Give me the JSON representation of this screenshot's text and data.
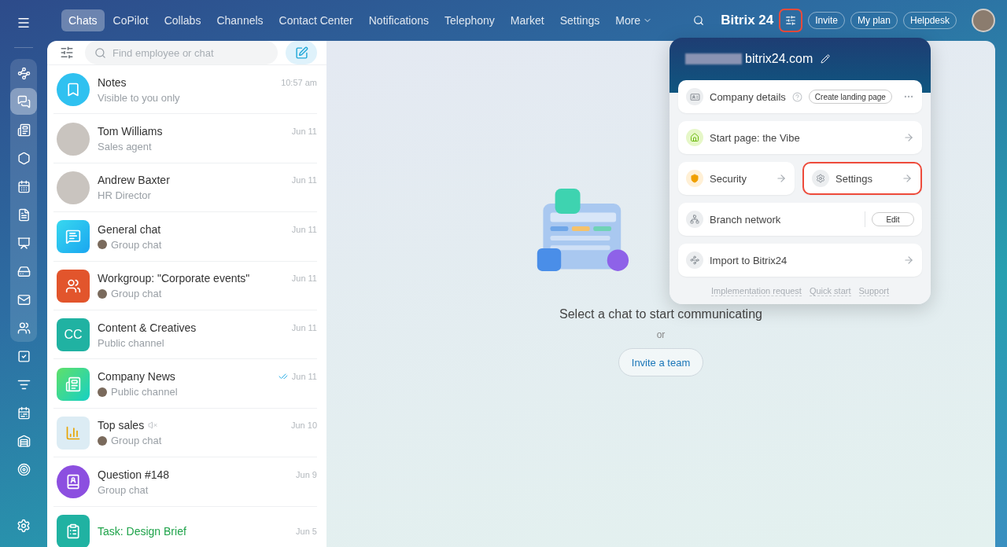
{
  "rail": {
    "items": [
      {
        "selected": false,
        "grouped": true
      },
      {
        "selected": true,
        "grouped": true
      },
      {
        "selected": false,
        "grouped": true
      },
      {
        "selected": false,
        "grouped": true
      },
      {
        "selected": false,
        "grouped": true
      },
      {
        "selected": false,
        "grouped": true
      },
      {
        "selected": false,
        "grouped": true
      },
      {
        "selected": false,
        "grouped": true
      },
      {
        "selected": false,
        "grouped": true
      },
      {
        "selected": false,
        "grouped": true
      },
      {
        "selected": false,
        "grouped": false
      },
      {
        "selected": false,
        "grouped": false
      },
      {
        "selected": false,
        "grouped": false
      },
      {
        "selected": false,
        "grouped": false
      },
      {
        "selected": false,
        "grouped": false
      }
    ]
  },
  "nav": {
    "tabs": [
      {
        "label": "Chats",
        "selected": true
      },
      {
        "label": "CoPilot",
        "selected": false
      },
      {
        "label": "Collabs",
        "selected": false
      },
      {
        "label": "Channels",
        "selected": false
      },
      {
        "label": "Contact Center",
        "selected": false
      },
      {
        "label": "Notifications",
        "selected": false
      },
      {
        "label": "Telephony",
        "selected": false
      },
      {
        "label": "Market",
        "selected": false
      },
      {
        "label": "Settings",
        "selected": false
      }
    ],
    "more": "More",
    "logo": "Bitrix 24",
    "settings_highlighted": true,
    "buttons": [
      "Invite",
      "My plan",
      "Helpdesk"
    ]
  },
  "chat_list": {
    "search": {
      "placeholder": "Find employee or chat"
    },
    "chats": [
      {
        "title": "Notes",
        "subtitle": "Visible to you only",
        "time": "10:57 am",
        "kind": "bookmark",
        "sender": false,
        "muted": false,
        "read": false,
        "task": false
      },
      {
        "title": "Tom Williams",
        "subtitle": "Sales agent",
        "time": "Jun 11",
        "kind": "photo",
        "sender": false,
        "muted": false,
        "read": false,
        "task": false
      },
      {
        "title": "Andrew Baxter",
        "subtitle": "HR Director",
        "time": "Jun 11",
        "kind": "photo",
        "sender": false,
        "muted": false,
        "read": false,
        "task": false
      },
      {
        "title": "General chat",
        "subtitle": "Group chat",
        "time": "Jun 11",
        "kind": "chat",
        "sender": true,
        "muted": false,
        "read": false,
        "task": false
      },
      {
        "title": "Workgroup: \"Corporate events\"",
        "subtitle": "Group chat",
        "time": "Jun 11",
        "kind": "group",
        "sender": true,
        "muted": false,
        "read": false,
        "task": false
      },
      {
        "title": "Content & Creatives",
        "subtitle": "Public channel",
        "time": "Jun 11",
        "kind": "initials",
        "initials": "CC",
        "sender": false,
        "muted": false,
        "read": false,
        "task": false
      },
      {
        "title": "Company News",
        "subtitle": "Public channel",
        "time": "Jun 11",
        "kind": "news",
        "sender": true,
        "muted": false,
        "read": true,
        "task": false
      },
      {
        "title": "Top sales",
        "subtitle": "Group chat",
        "time": "Jun 10",
        "kind": "chart",
        "sender": true,
        "muted": true,
        "read": false,
        "task": false
      },
      {
        "title": "Question #148",
        "subtitle": "Group chat",
        "time": "Jun 9",
        "kind": "question",
        "sender": false,
        "muted": false,
        "read": false,
        "task": false
      },
      {
        "title": "Task: Design Brief",
        "time": "Jun 5",
        "kind": "task",
        "sender": false,
        "muted": false,
        "read": false,
        "task": true
      }
    ]
  },
  "empty_state": {
    "message": "Select a chat to start communicating",
    "or": "or",
    "button": "Invite a team"
  },
  "popup": {
    "domain": "bitrix24.com",
    "rows": [
      {
        "kind": "company",
        "label": "Company details",
        "button": "Create landing page",
        "highlighted": false
      },
      {
        "kind": "link",
        "label": "Start page: the Vibe",
        "highlighted": false
      },
      {
        "kind": "pair",
        "items": [
          {
            "label": "Security",
            "highlighted": false
          },
          {
            "label": "Settings",
            "highlighted": true
          }
        ]
      },
      {
        "kind": "edit",
        "label": "Branch network",
        "button": "Edit",
        "highlighted": false
      },
      {
        "kind": "link",
        "label": "Import to Bitrix24",
        "highlighted": false
      }
    ],
    "footer_links": [
      "Implementation request",
      "Quick start",
      "Support"
    ]
  }
}
